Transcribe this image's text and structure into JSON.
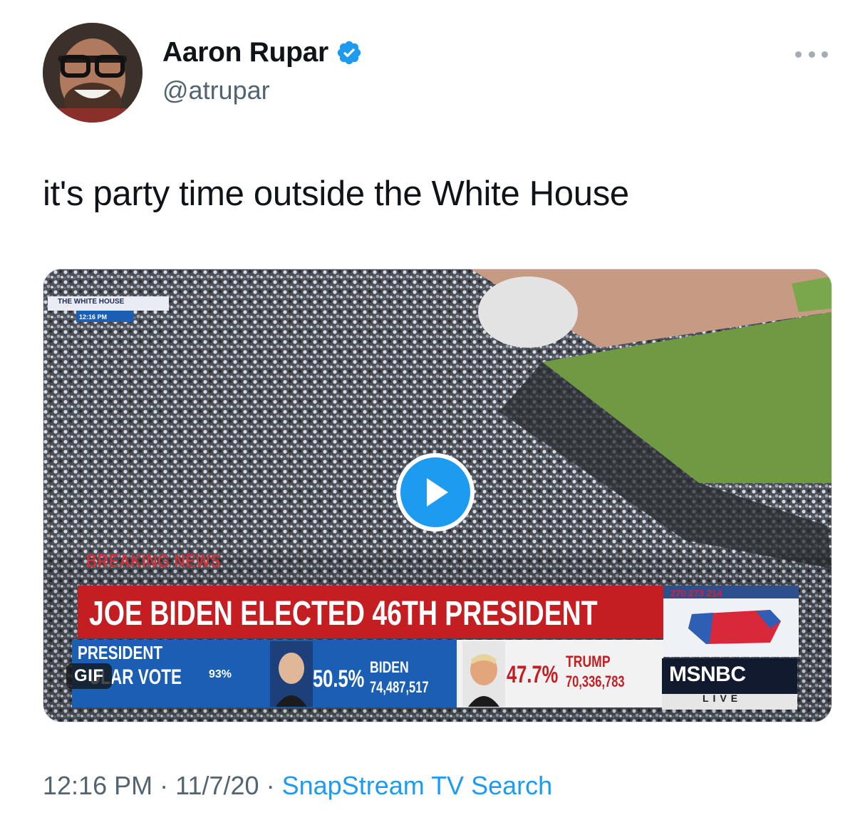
{
  "author": {
    "display_name": "Aaron Rupar",
    "handle": "@atrupar",
    "verified": true,
    "avatar_icon": "avatar-photo"
  },
  "tweet": {
    "text": "it's party time outside the White House"
  },
  "media": {
    "badge": "GIF",
    "overlay": {
      "corner_tag": "THE WHITE HOUSE",
      "corner_time": "12:16 PM",
      "breaking": "BREAKING NEWS",
      "headline": "JOE BIDEN ELECTED 46TH PRESIDENT",
      "popular_vote_line1": "PRESIDENT",
      "popular_vote_line2": "ULAR VOTE",
      "pv_percent_reporting": "93%",
      "biden_pct": "50.5%",
      "biden_name": "BIDEN",
      "biden_votes": "74,487,517",
      "trump_pct": "47.7%",
      "trump_name": "TRUMP",
      "trump_votes": "70,336,783",
      "map_tally": "270  273  214",
      "network": "MSNBC",
      "live": "LIVE"
    }
  },
  "meta": {
    "time": "12:16 PM",
    "separator": "·",
    "date": "11/7/20",
    "source": "SnapStream TV Search"
  },
  "colors": {
    "link": "#1d9bf0",
    "secondary_text": "#536471",
    "news_red": "#c41e23",
    "news_blue": "#1a5fb4"
  }
}
